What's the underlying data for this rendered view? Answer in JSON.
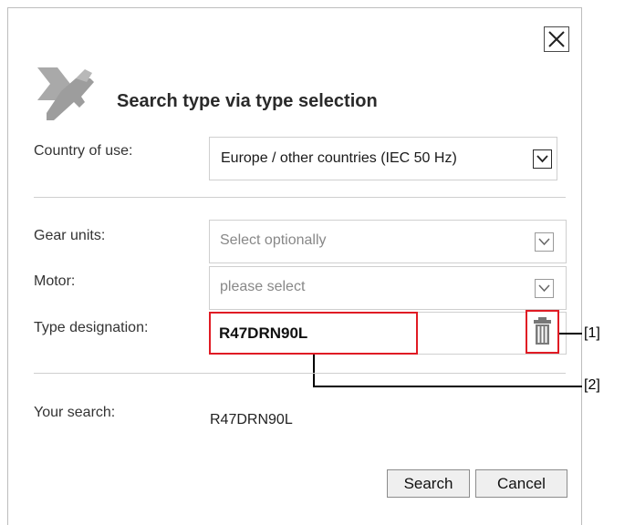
{
  "dialog": {
    "title": "Search type via type selection",
    "close_icon": "close-icon",
    "logo_icon": "tools-logo-icon"
  },
  "form": {
    "country_label": "Country of use:",
    "country_value": "Europe / other countries (IEC 50 Hz)",
    "gear_label": "Gear units:",
    "gear_value": "Select optionally",
    "motor_label": "Motor:",
    "motor_value": "please select",
    "type_label": "Type designation:",
    "type_value": "R47DRN90L",
    "delete_icon": "trash-icon",
    "search_label": "Your search:",
    "search_value": "R47DRN90L"
  },
  "buttons": {
    "search": "Search",
    "cancel": "Cancel"
  },
  "callouts": {
    "one": "[1]",
    "two": "[2]"
  },
  "colors": {
    "highlight": "#e01b24",
    "logo": "#a8a8a8"
  }
}
